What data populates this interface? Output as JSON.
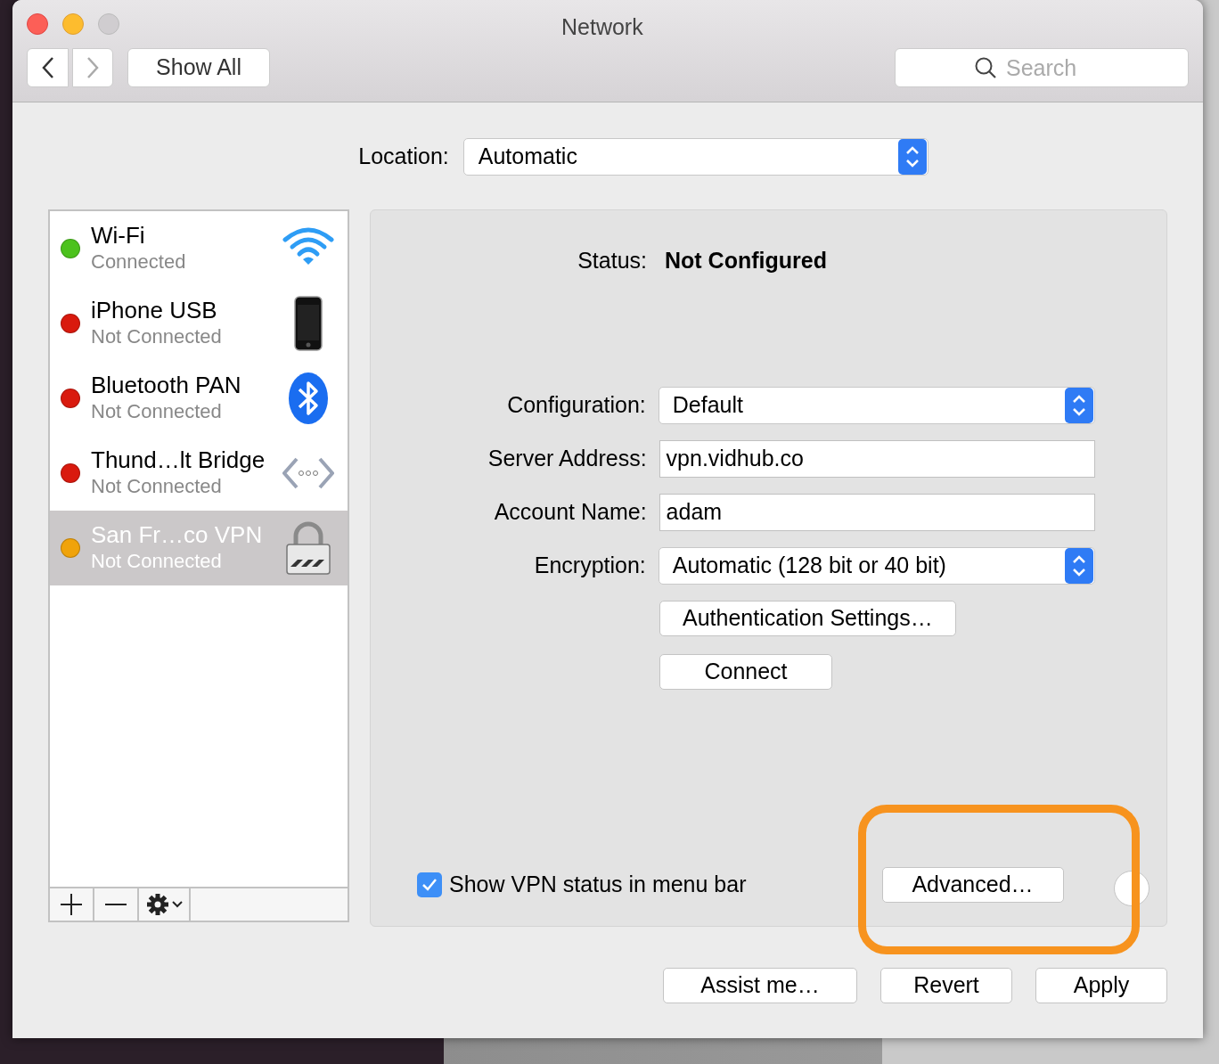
{
  "window": {
    "title": "Network"
  },
  "toolbar": {
    "show_all": "Show All",
    "search": {
      "placeholder": "Search"
    }
  },
  "location": {
    "label": "Location:",
    "value": "Automatic"
  },
  "services": [
    {
      "name": "Wi-Fi",
      "status": "Connected",
      "color": "#4cc21d",
      "kind": "wifi",
      "selected": false
    },
    {
      "name": "iPhone USB",
      "status": "Not Connected",
      "color": "#d91a0e",
      "kind": "phone",
      "selected": false
    },
    {
      "name": "Bluetooth PAN",
      "status": "Not Connected",
      "color": "#d91a0e",
      "kind": "bluetooth",
      "selected": false
    },
    {
      "name": "Thund…lt Bridge",
      "status": "Not Connected",
      "color": "#d91a0e",
      "kind": "bridge",
      "selected": false
    },
    {
      "name": "San Fr…co VPN",
      "status": "Not Connected",
      "color": "#f0a30a",
      "kind": "lock",
      "selected": true
    }
  ],
  "status": {
    "label": "Status:",
    "value": "Not Configured"
  },
  "fields": [
    {
      "label": "Configuration:",
      "value": "Default",
      "kind": "select"
    },
    {
      "label": "Server Address:",
      "value": "vpn.vidhub.co",
      "kind": "text"
    },
    {
      "label": "Account Name:",
      "value": "adam",
      "kind": "text"
    },
    {
      "label": "Encryption:",
      "value": "Automatic (128 bit or 40 bit)",
      "kind": "select"
    }
  ],
  "actions": [
    "Authentication Settings…",
    "Connect"
  ],
  "show_vpn_status": {
    "label": "Show VPN status in menu bar",
    "checked": true
  },
  "advanced_button": "Advanced…",
  "footer_buttons": [
    "Assist me…",
    "Revert",
    "Apply"
  ]
}
